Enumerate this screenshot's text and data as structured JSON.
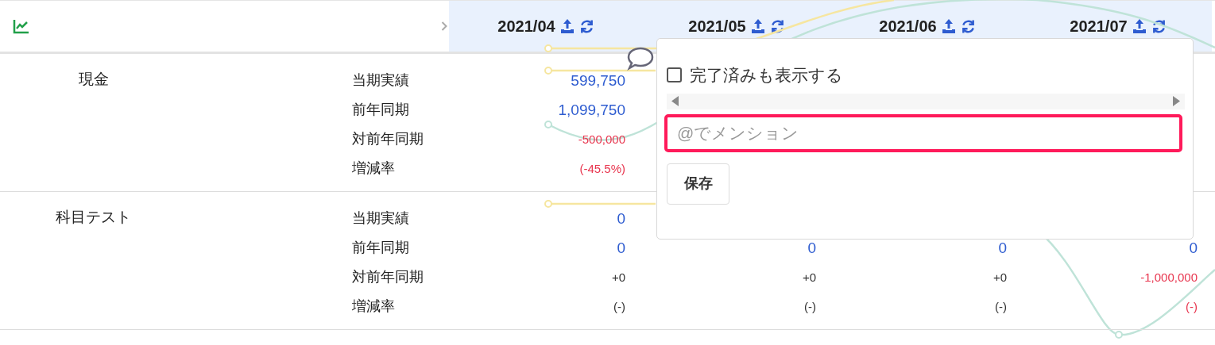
{
  "header": {
    "periods": [
      {
        "label": "2021/04"
      },
      {
        "label": "2021/05"
      },
      {
        "label": "2021/06"
      },
      {
        "label": "2021/07"
      }
    ]
  },
  "sections": [
    {
      "name": "現金",
      "rows": [
        {
          "label": "当期実績",
          "kind": "amount",
          "cells": [
            {
              "text": "599,750",
              "negative": false
            },
            null,
            null,
            null
          ]
        },
        {
          "label": "前年同期",
          "kind": "amount",
          "cells": [
            {
              "text": "1,099,750",
              "negative": false
            },
            null,
            null,
            null
          ]
        },
        {
          "label": "対前年同期",
          "kind": "change",
          "cells": [
            {
              "text": "-500,000",
              "negative": true
            },
            null,
            null,
            null
          ]
        },
        {
          "label": "増減率",
          "kind": "change",
          "cells": [
            {
              "text": "(-45.5%)",
              "negative": true
            },
            null,
            null,
            null
          ]
        }
      ]
    },
    {
      "name": "科目テスト",
      "rows": [
        {
          "label": "当期実績",
          "kind": "amount",
          "cells": [
            {
              "text": "0",
              "negative": false
            },
            null,
            null,
            null
          ]
        },
        {
          "label": "前年同期",
          "kind": "amount",
          "cells": [
            {
              "text": "0",
              "negative": false
            },
            {
              "text": "0",
              "negative": false
            },
            {
              "text": "0",
              "negative": false
            },
            {
              "text": "0",
              "negative": false
            }
          ]
        },
        {
          "label": "対前年同期",
          "kind": "change",
          "cells": [
            {
              "text": "+0",
              "negative": false
            },
            {
              "text": "+0",
              "negative": false
            },
            {
              "text": "+0",
              "negative": false
            },
            {
              "text": "-1,000,000",
              "negative": true
            }
          ]
        },
        {
          "label": "増減率",
          "kind": "change",
          "cells": [
            {
              "text": "(-)",
              "negative": false
            },
            {
              "text": "(-)",
              "negative": false
            },
            {
              "text": "(-)",
              "negative": false
            },
            {
              "text": "(-)",
              "negative": true
            }
          ]
        }
      ]
    }
  ],
  "popover": {
    "checkbox": {
      "label": "完了済みも表示する",
      "checked": false
    },
    "mention_field": {
      "placeholder": "@でメンション"
    },
    "save_button": "保存"
  }
}
